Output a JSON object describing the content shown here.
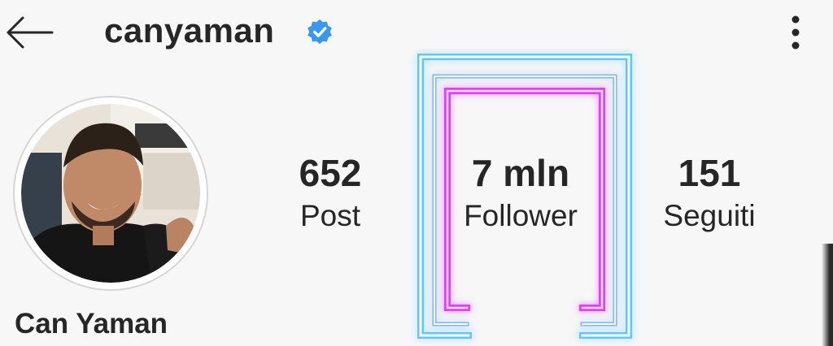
{
  "header": {
    "username": "canyaman",
    "verified_color": "#3897f0",
    "back_icon": "arrow-left-icon",
    "more_icon": "vertical-dots-icon"
  },
  "profile": {
    "display_name": "Can Yaman"
  },
  "stats": {
    "posts_count": "652",
    "posts_label": "Post",
    "followers_count": "7 mln",
    "followers_label": "Follower",
    "following_count": "151",
    "following_label": "Seguiti"
  },
  "overlay": {
    "outer_color": "#4fc3ff",
    "inner_color": "#e040fb"
  }
}
